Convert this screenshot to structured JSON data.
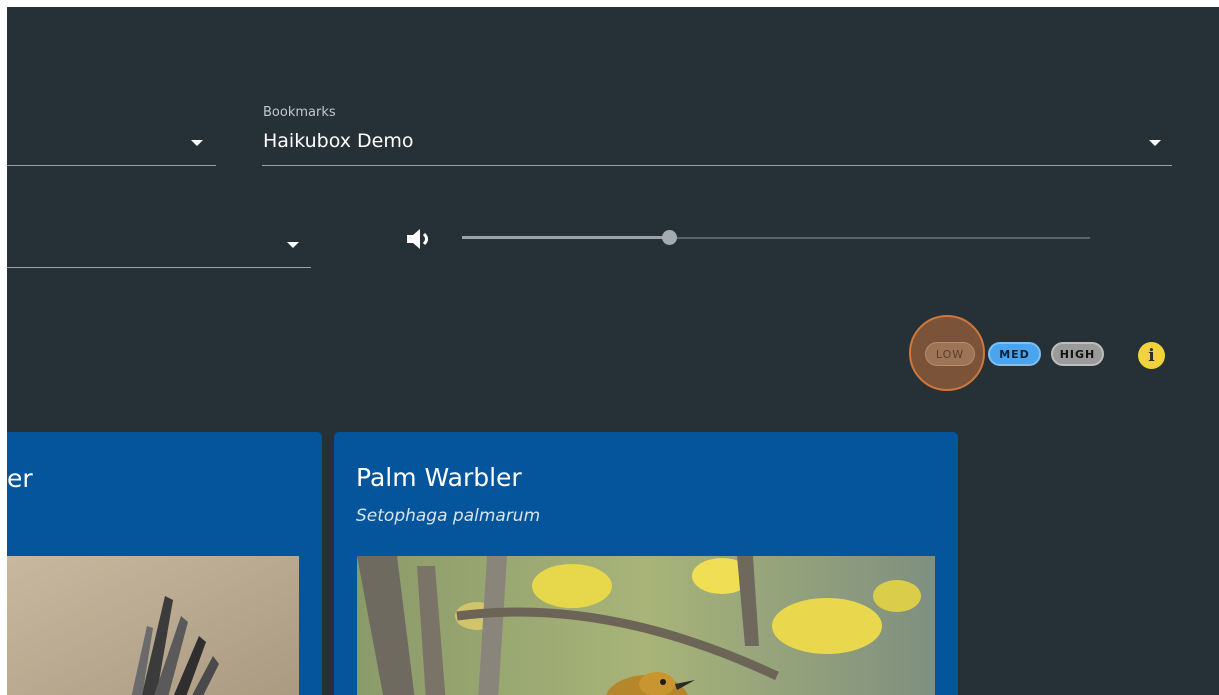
{
  "bookmarks": {
    "label": "Bookmarks",
    "value": "Haikubox Demo"
  },
  "volume": {
    "icon": "volume-up-icon",
    "level": 0.33
  },
  "confidence": {
    "low_label": "LOW",
    "med_label": "MED",
    "high_label": "HIGH",
    "selected": "LOW"
  },
  "info": {
    "icon": "info-icon",
    "glyph": "i"
  },
  "cards": [
    {
      "title_fragment": "er"
    },
    {
      "title": "Palm Warbler",
      "scientific_name": "Setophaga palmarum"
    }
  ],
  "colors": {
    "background": "#263037",
    "card": "#04559b",
    "low_chip": "#9e7457",
    "med_chip": "#4aa5ee",
    "high_chip": "#9a9a9a",
    "info": "#f2d33b",
    "focus_ring": "#d2763a"
  }
}
